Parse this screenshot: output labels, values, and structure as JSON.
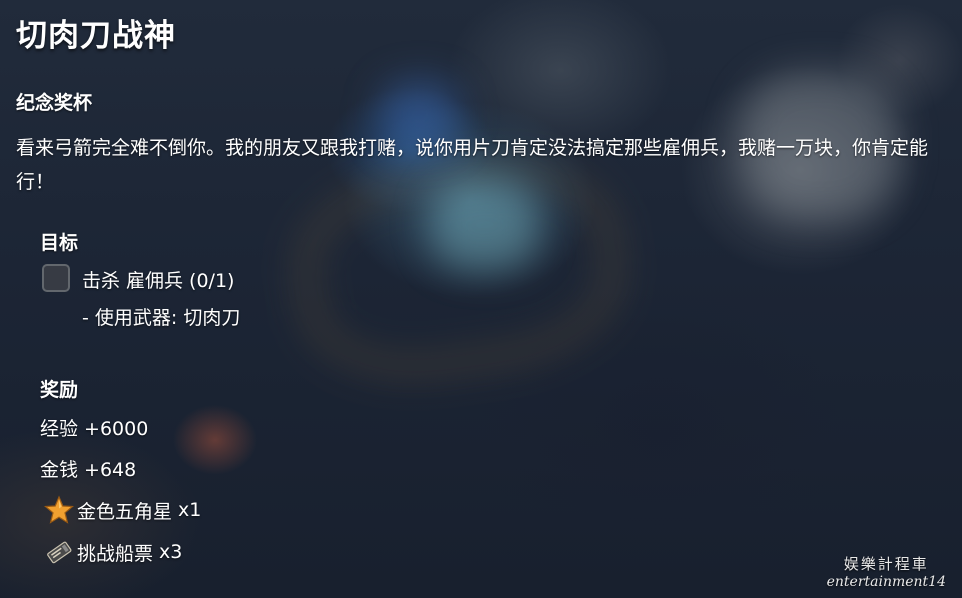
{
  "quest": {
    "title": "切肉刀战神",
    "category": "纪念奖杯",
    "description": "看来弓箭完全难不倒你。我的朋友又跟我打赌，说你用片刀肯定没法搞定那些雇佣兵，我赌一万块，你肯定能行！"
  },
  "objectives": {
    "heading": "目标",
    "items": [
      {
        "text": "击杀 雇佣兵",
        "progress": "(0/1)",
        "condition": "- 使用武器: 切肉刀",
        "completed": false
      }
    ]
  },
  "rewards": {
    "heading": "奖励",
    "items": [
      {
        "text": "经验 +6000"
      },
      {
        "text": "金钱 +648"
      },
      {
        "icon": "gold-star-icon",
        "name": "金色五角星",
        "qty": "x1"
      },
      {
        "icon": "challenge-ticket-icon",
        "name": "挑战船票",
        "qty": "x3"
      }
    ]
  },
  "watermark": {
    "line1": "娱樂計程車",
    "line2": "entertainment14"
  },
  "colors": {
    "text": "#ffffff",
    "background": "#1a2333",
    "star": "#f0a030",
    "checkbox_border": "#6e7378"
  }
}
